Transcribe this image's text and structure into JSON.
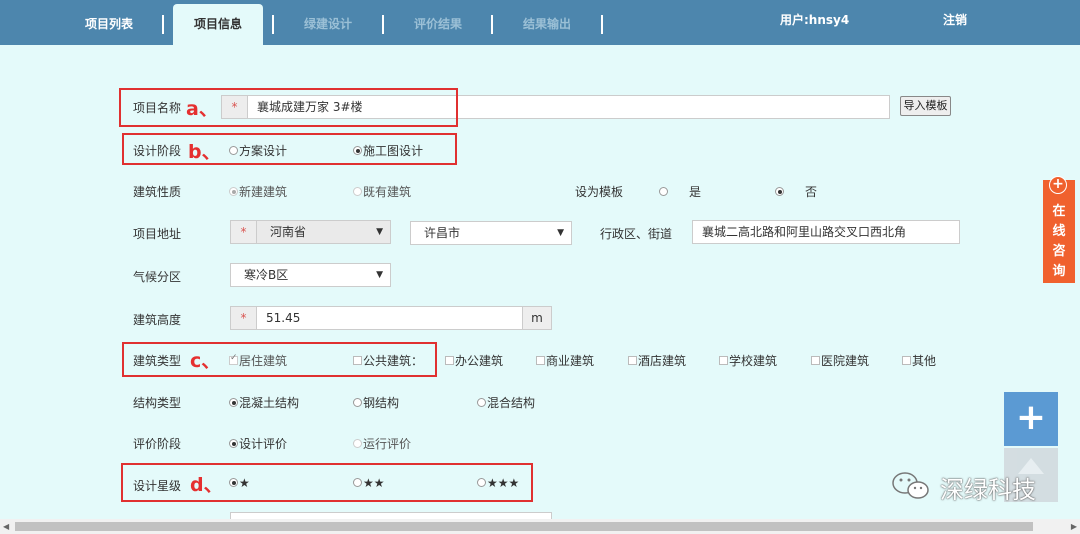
{
  "nav": {
    "tabs": [
      {
        "label": "项目列表",
        "state": "normal"
      },
      {
        "label": "项目信息",
        "state": "active"
      },
      {
        "label": "绿建设计",
        "state": "disabled"
      },
      {
        "label": "评价结果",
        "state": "disabled"
      },
      {
        "label": "结果输出",
        "state": "disabled"
      }
    ],
    "user": "用户:hnsy4",
    "logout": "注销"
  },
  "form": {
    "required_mark": "*",
    "project_name": {
      "label": "项目名称",
      "value": "襄城成建万家 3#楼",
      "import_button": "导入模板"
    },
    "design_stage": {
      "label": "设计阶段",
      "options": [
        "方案设计",
        "施工图设计"
      ],
      "selected": "施工图设计"
    },
    "building_nature": {
      "label": "建筑性质",
      "options": [
        "新建建筑",
        "既有建筑"
      ],
      "selected": "新建建筑"
    },
    "template": {
      "label": "设为模板",
      "options": [
        "是",
        "否"
      ],
      "selected": "否"
    },
    "address": {
      "label": "项目地址",
      "province": "河南省",
      "city": "许昌市",
      "district_label": "行政区、街道",
      "street": "襄城二高北路和阿里山路交叉口西北角"
    },
    "climate": {
      "label": "气候分区",
      "value": "寒冷B区"
    },
    "height": {
      "label": "建筑高度",
      "value": "51.45",
      "unit": "m"
    },
    "building_type": {
      "label": "建筑类型",
      "options": [
        "居住建筑",
        "公共建筑：",
        "办公建筑",
        "商业建筑",
        "酒店建筑",
        "学校建筑",
        "医院建筑",
        "其他"
      ],
      "checked": [
        "居住建筑"
      ]
    },
    "structure": {
      "label": "结构类型",
      "options": [
        "混凝土结构",
        "钢结构",
        "混合结构"
      ],
      "selected": "混凝土结构"
    },
    "eval_stage": {
      "label": "评价阶段",
      "options": [
        "设计评价",
        "运行评价"
      ],
      "selected": "设计评价"
    },
    "star_level": {
      "label": "设计星级",
      "options": [
        "★",
        "★★",
        "★★★"
      ],
      "selected": "★"
    }
  },
  "annotations": [
    "a、",
    "b、",
    "c、",
    "d、"
  ],
  "colors": {
    "nav": "#4d86ad",
    "background": "#e4fafa",
    "annotation": "#e03030",
    "consult": "#f0612e",
    "fab": "#5b9ad3"
  },
  "sidebar": {
    "consult_chars": [
      "在",
      "线",
      "咨",
      "询"
    ],
    "consult_icon": "plus-circle-icon",
    "fab_label": "+"
  },
  "watermark": {
    "text": "深绿科技",
    "icon": "wechat-icon"
  }
}
